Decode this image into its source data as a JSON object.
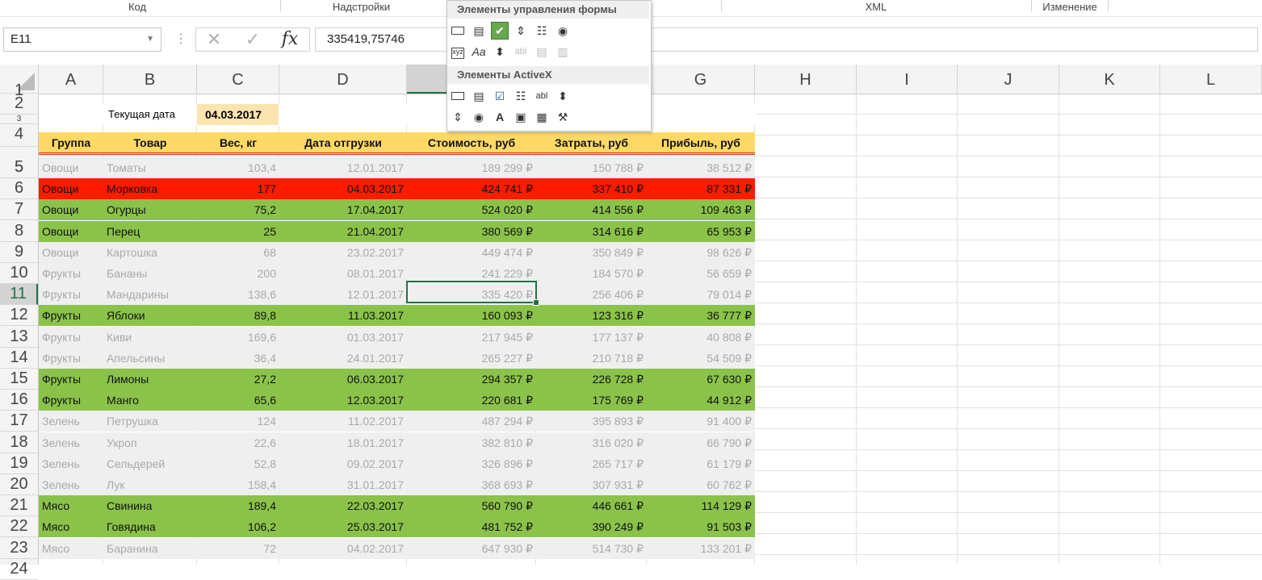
{
  "ribbon": {
    "groups": [
      "Код",
      "Надстройки",
      "XML",
      "Изменение"
    ]
  },
  "formula_bar": {
    "name_box": "E11",
    "cancel_glyph": "✕",
    "enter_glyph": "✓",
    "fx_label": "fx",
    "formula": "335419,75746"
  },
  "controls_popup": {
    "form_title": "Элементы управления формы",
    "activex_title": "Элементы ActiveX",
    "form_icons": [
      "button-icon",
      "combo-box-icon",
      "checkbox-icon",
      "spin-button-icon",
      "list-box-icon",
      "option-button-icon",
      "group-box-icon",
      "label-icon",
      "scroll-bar-icon",
      "text-field-icon",
      "combo-list-edit-icon",
      "combo-drop-edit-icon"
    ],
    "activex_icons": [
      "command-button-icon",
      "combo-box-icon",
      "checkbox-icon",
      "list-box-icon",
      "text-box-icon",
      "scroll-bar-icon",
      "spin-button-icon",
      "option-button-icon",
      "label-icon",
      "image-icon",
      "toggle-button-icon",
      "more-controls-icon"
    ]
  },
  "columns": [
    "A",
    "B",
    "C",
    "D",
    "E",
    "F",
    "G",
    "H",
    "I",
    "J",
    "K",
    "L"
  ],
  "selected_column": "E",
  "selected_row": "11",
  "rows_visible": [
    "1",
    "2",
    "3",
    "4",
    "5",
    "6",
    "7",
    "8",
    "9",
    "10",
    "11",
    "12",
    "13",
    "14",
    "15",
    "16",
    "17",
    "18",
    "19",
    "20",
    "21",
    "22",
    "23",
    "24"
  ],
  "current_date": {
    "label": "Текущая дата",
    "value": "04.03.2017"
  },
  "table": {
    "headers": [
      "Группа",
      "Товар",
      "Вес, кг",
      "Дата отгрузки",
      "Стоимость, руб",
      "Затраты, руб",
      "Прибыль, руб"
    ],
    "rows": [
      {
        "style": "grey",
        "cells": [
          "Овощи",
          "Томаты",
          "103,4",
          "12.01.2017",
          "189 299 ₽",
          "150 788 ₽",
          "38 512 ₽"
        ]
      },
      {
        "style": "red",
        "cells": [
          "Овощи",
          "Морковка",
          "177",
          "04.03.2017",
          "424 741 ₽",
          "337 410 ₽",
          "87 331 ₽"
        ]
      },
      {
        "style": "green",
        "cells": [
          "Овощи",
          "Огурцы",
          "75,2",
          "17.04.2017",
          "524 020 ₽",
          "414 556 ₽",
          "109 463 ₽"
        ]
      },
      {
        "style": "green",
        "cells": [
          "Овощи",
          "Перец",
          "25",
          "21.04.2017",
          "380 569 ₽",
          "314 616 ₽",
          "65 953 ₽"
        ]
      },
      {
        "style": "grey",
        "cells": [
          "Овощи",
          "Картошка",
          "68",
          "23.02.2017",
          "449 474 ₽",
          "350 849 ₽",
          "98 626 ₽"
        ]
      },
      {
        "style": "grey",
        "cells": [
          "Фрукты",
          "Бананы",
          "200",
          "08.01.2017",
          "241 229 ₽",
          "184 570 ₽",
          "56 659 ₽"
        ]
      },
      {
        "style": "grey",
        "cells": [
          "Фрукты",
          "Мандарины",
          "138,6",
          "12.01.2017",
          "335 420 ₽",
          "256 406 ₽",
          "79 014 ₽"
        ]
      },
      {
        "style": "green",
        "cells": [
          "Фрукты",
          "Яблоки",
          "89,8",
          "11.03.2017",
          "160 093 ₽",
          "123 316 ₽",
          "36 777 ₽"
        ]
      },
      {
        "style": "grey",
        "cells": [
          "Фрукты",
          "Киви",
          "169,6",
          "01.03.2017",
          "217 945 ₽",
          "177 137 ₽",
          "40 808 ₽"
        ]
      },
      {
        "style": "grey",
        "cells": [
          "Фрукты",
          "Апельсины",
          "36,4",
          "24.01.2017",
          "265 227 ₽",
          "210 718 ₽",
          "54 509 ₽"
        ]
      },
      {
        "style": "green",
        "cells": [
          "Фрукты",
          "Лимоны",
          "27,2",
          "06.03.2017",
          "294 357 ₽",
          "226 728 ₽",
          "67 630 ₽"
        ]
      },
      {
        "style": "green",
        "cells": [
          "Фрукты",
          "Манго",
          "65,6",
          "12.03.2017",
          "220 681 ₽",
          "175 769 ₽",
          "44 912 ₽"
        ]
      },
      {
        "style": "grey",
        "cells": [
          "Зелень",
          "Петрушка",
          "124",
          "11.02.2017",
          "487 294 ₽",
          "395 893 ₽",
          "91 400 ₽"
        ]
      },
      {
        "style": "grey",
        "cells": [
          "Зелень",
          "Укроп",
          "22,6",
          "18.01.2017",
          "382 810 ₽",
          "316 020 ₽",
          "66 790 ₽"
        ]
      },
      {
        "style": "grey",
        "cells": [
          "Зелень",
          "Сельдерей",
          "52,8",
          "09.02.2017",
          "326 896 ₽",
          "265 717 ₽",
          "61 179 ₽"
        ]
      },
      {
        "style": "grey",
        "cells": [
          "Зелень",
          "Лук",
          "158,4",
          "31.01.2017",
          "368 693 ₽",
          "307 931 ₽",
          "60 762 ₽"
        ]
      },
      {
        "style": "green",
        "cells": [
          "Мясо",
          "Свинина",
          "189,4",
          "22.03.2017",
          "560 790 ₽",
          "446 661 ₽",
          "114 129 ₽"
        ]
      },
      {
        "style": "green",
        "cells": [
          "Мясо",
          "Говядина",
          "106,2",
          "25.03.2017",
          "481 752 ₽",
          "390 249 ₽",
          "91 503 ₽"
        ]
      },
      {
        "style": "grey",
        "cells": [
          "Мясо",
          "Баранина",
          "72",
          "04.02.2017",
          "647 930 ₽",
          "514 730 ₽",
          "133 201 ₽"
        ]
      }
    ]
  },
  "colors": {
    "header_fill": "#ffd966",
    "highlight_green": "#8bc34a",
    "highlight_red": "#ff1a00",
    "dim_fill": "#efefef",
    "excel_green": "#217346"
  }
}
